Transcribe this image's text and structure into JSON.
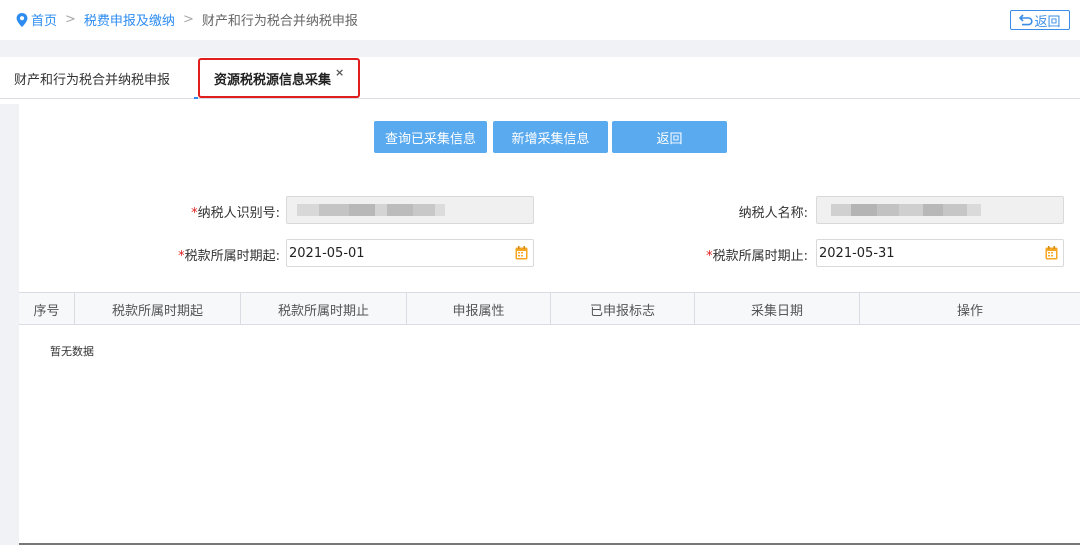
{
  "breadcrumb": {
    "home": "首页",
    "section": "税费申报及缴纳",
    "current": "财产和行为税合并纳税申报",
    "separator": ">"
  },
  "header": {
    "back_label": "返回"
  },
  "tabs": [
    {
      "label": "财产和行为税合并纳税申报"
    },
    {
      "label": "资源税税源信息采集",
      "close": "×",
      "active": true
    }
  ],
  "actions": {
    "query_label": "查询已采集信息",
    "add_label": "新增采集信息",
    "back_label": "返回"
  },
  "form": {
    "required_mark": "*",
    "taxpayer_id_label": "纳税人识别号:",
    "taxpayer_name_label": "纳税人名称:",
    "period_start_label": "税款所属时期起:",
    "period_start_value": "2021-05-01",
    "period_end_label": "税款所属时期止:",
    "period_end_value": "2021-05-31"
  },
  "table": {
    "columns": [
      "序号",
      "税款所属时期起",
      "税款所属时期止",
      "申报属性",
      "已申报标志",
      "采集日期",
      "操作"
    ],
    "empty_text": "暂无数据"
  },
  "icons": {
    "location": "location-pin-icon",
    "back": "return-arrow-icon",
    "calendar": "calendar-icon"
  },
  "colors": {
    "accent": "#2d8cf0",
    "button": "#5aaaf0",
    "highlight_border": "#e01e1e",
    "required": "#e01e1e"
  }
}
